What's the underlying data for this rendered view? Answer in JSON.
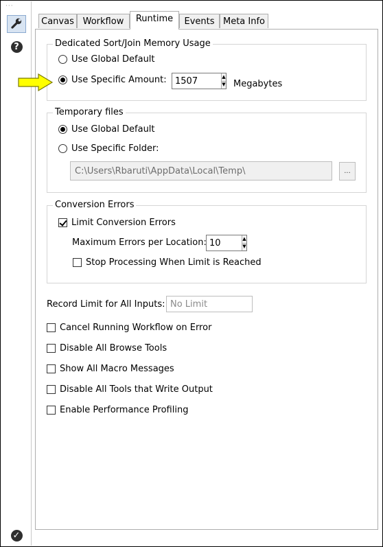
{
  "tabs": [
    {
      "label": "Canvas",
      "active": false
    },
    {
      "label": "Workflow",
      "active": false
    },
    {
      "label": "Runtime",
      "active": true
    },
    {
      "label": "Events",
      "active": false
    },
    {
      "label": "Meta Info",
      "active": false
    }
  ],
  "sidebar": {
    "grip": "···",
    "tools": [
      {
        "icon": "wrench-icon",
        "active": true
      },
      {
        "icon": "help-icon",
        "glyph": "?"
      },
      {
        "icon": "check-icon",
        "glyph": "✓"
      }
    ]
  },
  "sort_join": {
    "title": "Dedicated Sort/Join Memory Usage",
    "global_default_label": "Use Global Default",
    "specific_amount_label": "Use Specific Amount:",
    "selected": "specific",
    "amount_value": "1507",
    "unit_label": "Megabytes",
    "highlight_arrow_color": "#ffff00"
  },
  "temp_files": {
    "title": "Temporary files",
    "global_default_label": "Use Global Default",
    "specific_folder_label": "Use Specific Folder:",
    "selected": "global",
    "folder_path": "C:\\Users\\Rbaruti\\AppData\\Local\\Temp\\",
    "browse_label": "..."
  },
  "conversion_errors": {
    "title": "Conversion Errors",
    "limit_label": "Limit Conversion Errors",
    "limit_checked": true,
    "max_errors_label": "Maximum Errors per Location:",
    "max_errors_value": "10",
    "stop_label": "Stop Processing When Limit is Reached",
    "stop_checked": false
  },
  "record_limit": {
    "label": "Record Limit for All Inputs:",
    "placeholder": "No Limit"
  },
  "options": [
    {
      "label": "Cancel Running Workflow on Error",
      "checked": false
    },
    {
      "label": "Disable All Browse Tools",
      "checked": false
    },
    {
      "label": "Show All Macro Messages",
      "checked": false
    },
    {
      "label": "Disable All Tools that Write Output",
      "checked": false
    },
    {
      "label": "Enable Performance Profiling",
      "checked": false
    }
  ],
  "spin_up": "▲",
  "spin_down": "▼"
}
